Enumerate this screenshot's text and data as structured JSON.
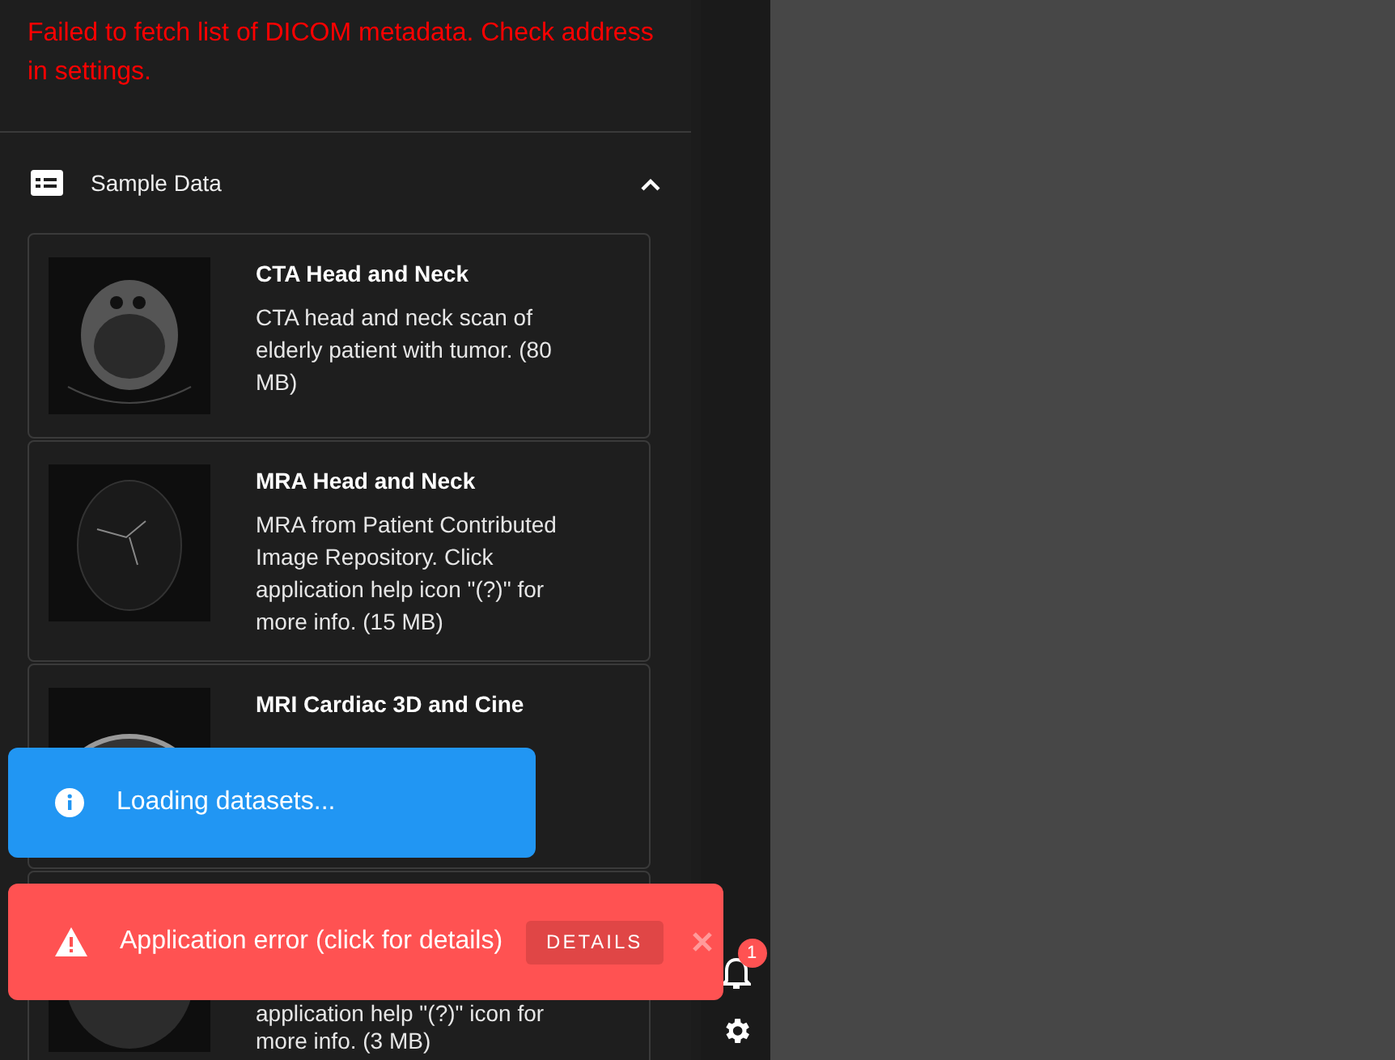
{
  "error_message": "Failed to fetch list of DICOM metadata. Check address in settings.",
  "sample_data": {
    "title": "Sample Data",
    "expanded": true,
    "datasets": [
      {
        "title": "CTA Head and Neck",
        "description": "CTA head and neck scan of elderly patient with tumor. (80 MB)",
        "kind": "ct"
      },
      {
        "title": "MRA Head and Neck",
        "description": "MRA from Patient Contributed Image Repository. Click application help icon \"(?)\" for more info. (15 MB)",
        "kind": "mra"
      },
      {
        "title": "MRI Cardiac 3D and Cine",
        "kind": "cardiac"
      },
      {
        "description": "application help \"(?)\" icon for more info. (3 MB)",
        "kind": "brain"
      }
    ]
  },
  "notifications": [
    {
      "kind": "info",
      "message": "Loading datasets..."
    },
    {
      "kind": "error",
      "message": "Application error (click for details)",
      "action": "DETAILS"
    }
  ],
  "notification_count": "1"
}
